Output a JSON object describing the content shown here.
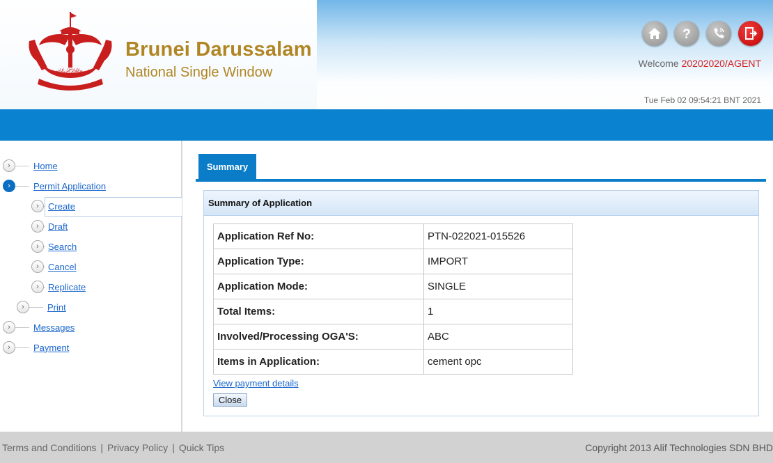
{
  "header": {
    "brand_title": "Brunei Darussalam",
    "brand_subtitle": "National Single Window",
    "welcome_prefix": "Welcome",
    "user": "20202020/AGENT",
    "datetime": "Tue Feb 02 09:54:21 BNT 2021",
    "icons": [
      "home-icon",
      "help-icon",
      "phone-icon",
      "logout-icon"
    ]
  },
  "sidebar": {
    "items": [
      {
        "label": "Home"
      },
      {
        "label": "Permit Application"
      },
      {
        "label": "Create"
      },
      {
        "label": "Draft"
      },
      {
        "label": "Search"
      },
      {
        "label": "Cancel"
      },
      {
        "label": "Replicate"
      },
      {
        "label": "Print"
      },
      {
        "label": "Messages"
      },
      {
        "label": "Payment"
      }
    ]
  },
  "main": {
    "tab": "Summary",
    "panel_title": "Summary of Application",
    "rows": [
      {
        "key": "Application Ref No:",
        "value": "PTN-022021-015526"
      },
      {
        "key": "Application Type:",
        "value": "IMPORT"
      },
      {
        "key": "Application Mode:",
        "value": "SINGLE"
      },
      {
        "key": "Total Items:",
        "value": "1"
      },
      {
        "key": "Involved/Processing OGA'S:",
        "value": "ABC"
      },
      {
        "key": "Items in Application:",
        "value": "cement opc"
      }
    ],
    "payment_link": "View payment details",
    "close_label": "Close"
  },
  "footer": {
    "terms": "Terms and Conditions",
    "privacy": "Privacy Policy",
    "quick_tips": "Quick Tips",
    "separator": "|",
    "copyright": "Copyright 2013 Alif Technologies SDN BHD"
  },
  "colors": {
    "accent_blue": "#0a82cf",
    "brand_gold": "#b08624",
    "user_red": "#d32020"
  }
}
